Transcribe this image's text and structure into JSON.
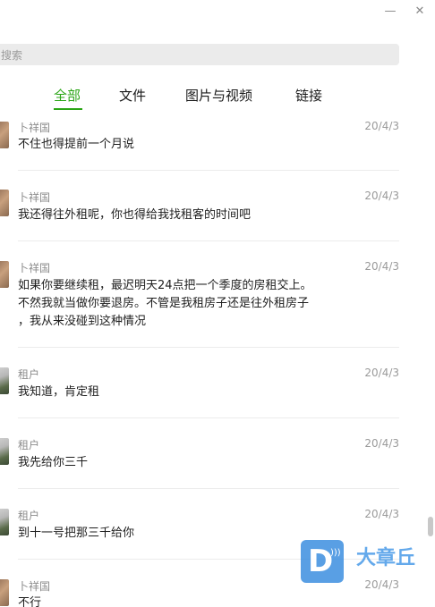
{
  "window": {
    "minimize_glyph": "—",
    "close_glyph": "✕"
  },
  "search": {
    "placeholder": "搜索"
  },
  "tabs": [
    {
      "label": "全部",
      "active": true
    },
    {
      "label": "文件",
      "active": false
    },
    {
      "label": "图片与视频",
      "active": false
    },
    {
      "label": "链接",
      "active": false
    }
  ],
  "messages": [
    {
      "sender": "卜祥国",
      "date": "20/4/3",
      "text": "不住也得提前一个月说"
    },
    {
      "sender": "卜祥国",
      "date": "20/4/3",
      "text": "我还得往外租呢，你也得给我找租客的时间吧"
    },
    {
      "sender": "卜祥国",
      "date": "20/4/3",
      "text": "如果你要继续租，最迟明天24点把一个季度的房租交上。\n不然我就当做你要退房。不管是我租房子还是往外租房子\n，我从来没碰到这种情况"
    },
    {
      "sender": "租户",
      "date": "20/4/3",
      "text": "我知道，肯定租"
    },
    {
      "sender": "租户",
      "date": "20/4/3",
      "text": "我先给你三千"
    },
    {
      "sender": "租户",
      "date": "20/4/3",
      "text": "到十一号把那三千给你"
    },
    {
      "sender": "卜祥国",
      "date": "20/4/3",
      "text": "不行"
    }
  ],
  "watermark": {
    "logo_letter": "D",
    "text": "大章丘"
  },
  "colors": {
    "accent": "#2aa515",
    "watermark": "#3d8fe0"
  }
}
